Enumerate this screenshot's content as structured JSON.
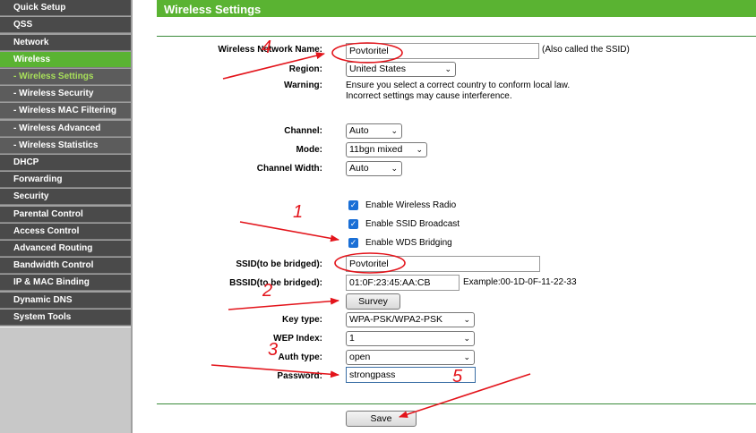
{
  "sidebar": {
    "items": [
      {
        "label": "Quick Setup"
      },
      {
        "label": "QSS"
      },
      {
        "label": "Network"
      },
      {
        "label": "Wireless"
      },
      {
        "label": "- Wireless Settings"
      },
      {
        "label": "- Wireless Security"
      },
      {
        "label": "- Wireless MAC Filtering"
      },
      {
        "label": "- Wireless Advanced"
      },
      {
        "label": "- Wireless Statistics"
      },
      {
        "label": "DHCP"
      },
      {
        "label": "Forwarding"
      },
      {
        "label": "Security"
      },
      {
        "label": "Parental Control"
      },
      {
        "label": "Access Control"
      },
      {
        "label": "Advanced Routing"
      },
      {
        "label": "Bandwidth Control"
      },
      {
        "label": "IP & MAC Binding"
      },
      {
        "label": "Dynamic DNS"
      },
      {
        "label": "System Tools"
      }
    ]
  },
  "header": {
    "title": "Wireless Settings"
  },
  "form": {
    "ssid_label": "Wireless Network Name:",
    "ssid_value": "Povtoritel",
    "ssid_note": "(Also called the SSID)",
    "region_label": "Region:",
    "region_value": "United States",
    "warning_label": "Warning:",
    "warning_line1": "Ensure you select a correct country to conform local law.",
    "warning_line2": "Incorrect settings may cause interference.",
    "channel_label": "Channel:",
    "channel_value": "Auto",
    "mode_label": "Mode:",
    "mode_value": "11bgn mixed",
    "width_label": "Channel Width:",
    "width_value": "Auto",
    "enable_radio": "Enable Wireless Radio",
    "enable_ssid_broadcast": "Enable SSID Broadcast",
    "enable_wds": "Enable WDS Bridging",
    "bridged_ssid_label": "SSID(to be bridged):",
    "bridged_ssid_value": "Povtoritel",
    "bssid_label": "BSSID(to be bridged):",
    "bssid_value": "01:0F:23:45:AA:CB",
    "bssid_example": "Example:00-1D-0F-11-22-33",
    "survey_label": "Survey",
    "key_type_label": "Key type:",
    "key_type_value": "WPA-PSK/WPA2-PSK",
    "wep_index_label": "WEP Index:",
    "wep_index_value": "1",
    "auth_type_label": "Auth type:",
    "auth_type_value": "open",
    "password_label": "Password:",
    "password_value": "strongpass",
    "save_label": "Save"
  },
  "annotations": {
    "numbers": [
      "4",
      "1",
      "2",
      "3",
      "5"
    ],
    "color": "#e3141b"
  },
  "colors": {
    "accent": "#5ab332",
    "sidebar_dark": "#4a4a4a",
    "active_sub_text": "#a8e05a"
  }
}
